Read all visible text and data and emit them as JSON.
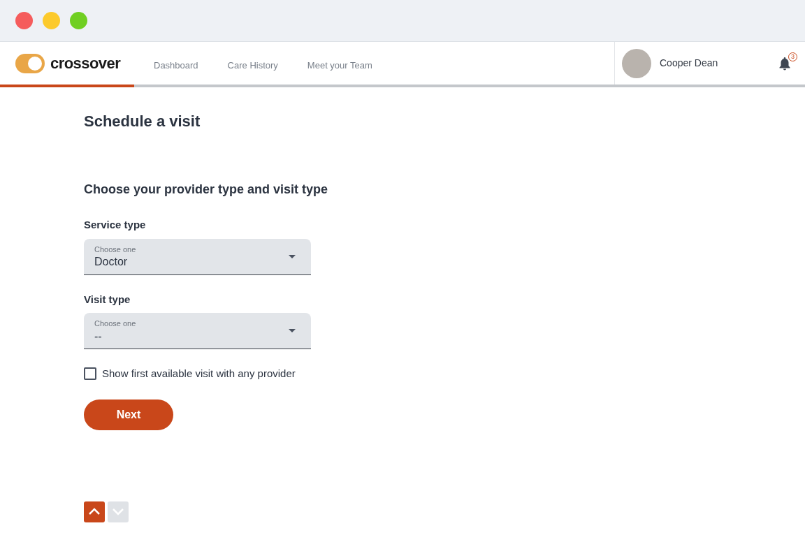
{
  "header": {
    "brand": "crossover",
    "nav": [
      {
        "label": "Dashboard"
      },
      {
        "label": "Care History"
      },
      {
        "label": "Meet your Team"
      }
    ],
    "user": {
      "name": "Cooper Dean"
    },
    "notifications": {
      "count": "3"
    },
    "progress": {
      "level": 0.167
    }
  },
  "page": {
    "title": "Schedule a visit",
    "section_title": "Choose your provider type and visit type",
    "fields": [
      {
        "label": "Service type",
        "placeholder": "Choose one",
        "value": "Doctor"
      },
      {
        "label": "Visit type",
        "placeholder": "Choose one",
        "value": "--"
      }
    ],
    "checkbox": {
      "label": "Show first available visit with any provider",
      "checked": false
    },
    "next_button": "Next"
  },
  "pager": [
    {
      "kind": "up",
      "disabled": false
    },
    {
      "kind": "down",
      "disabled": true
    }
  ]
}
